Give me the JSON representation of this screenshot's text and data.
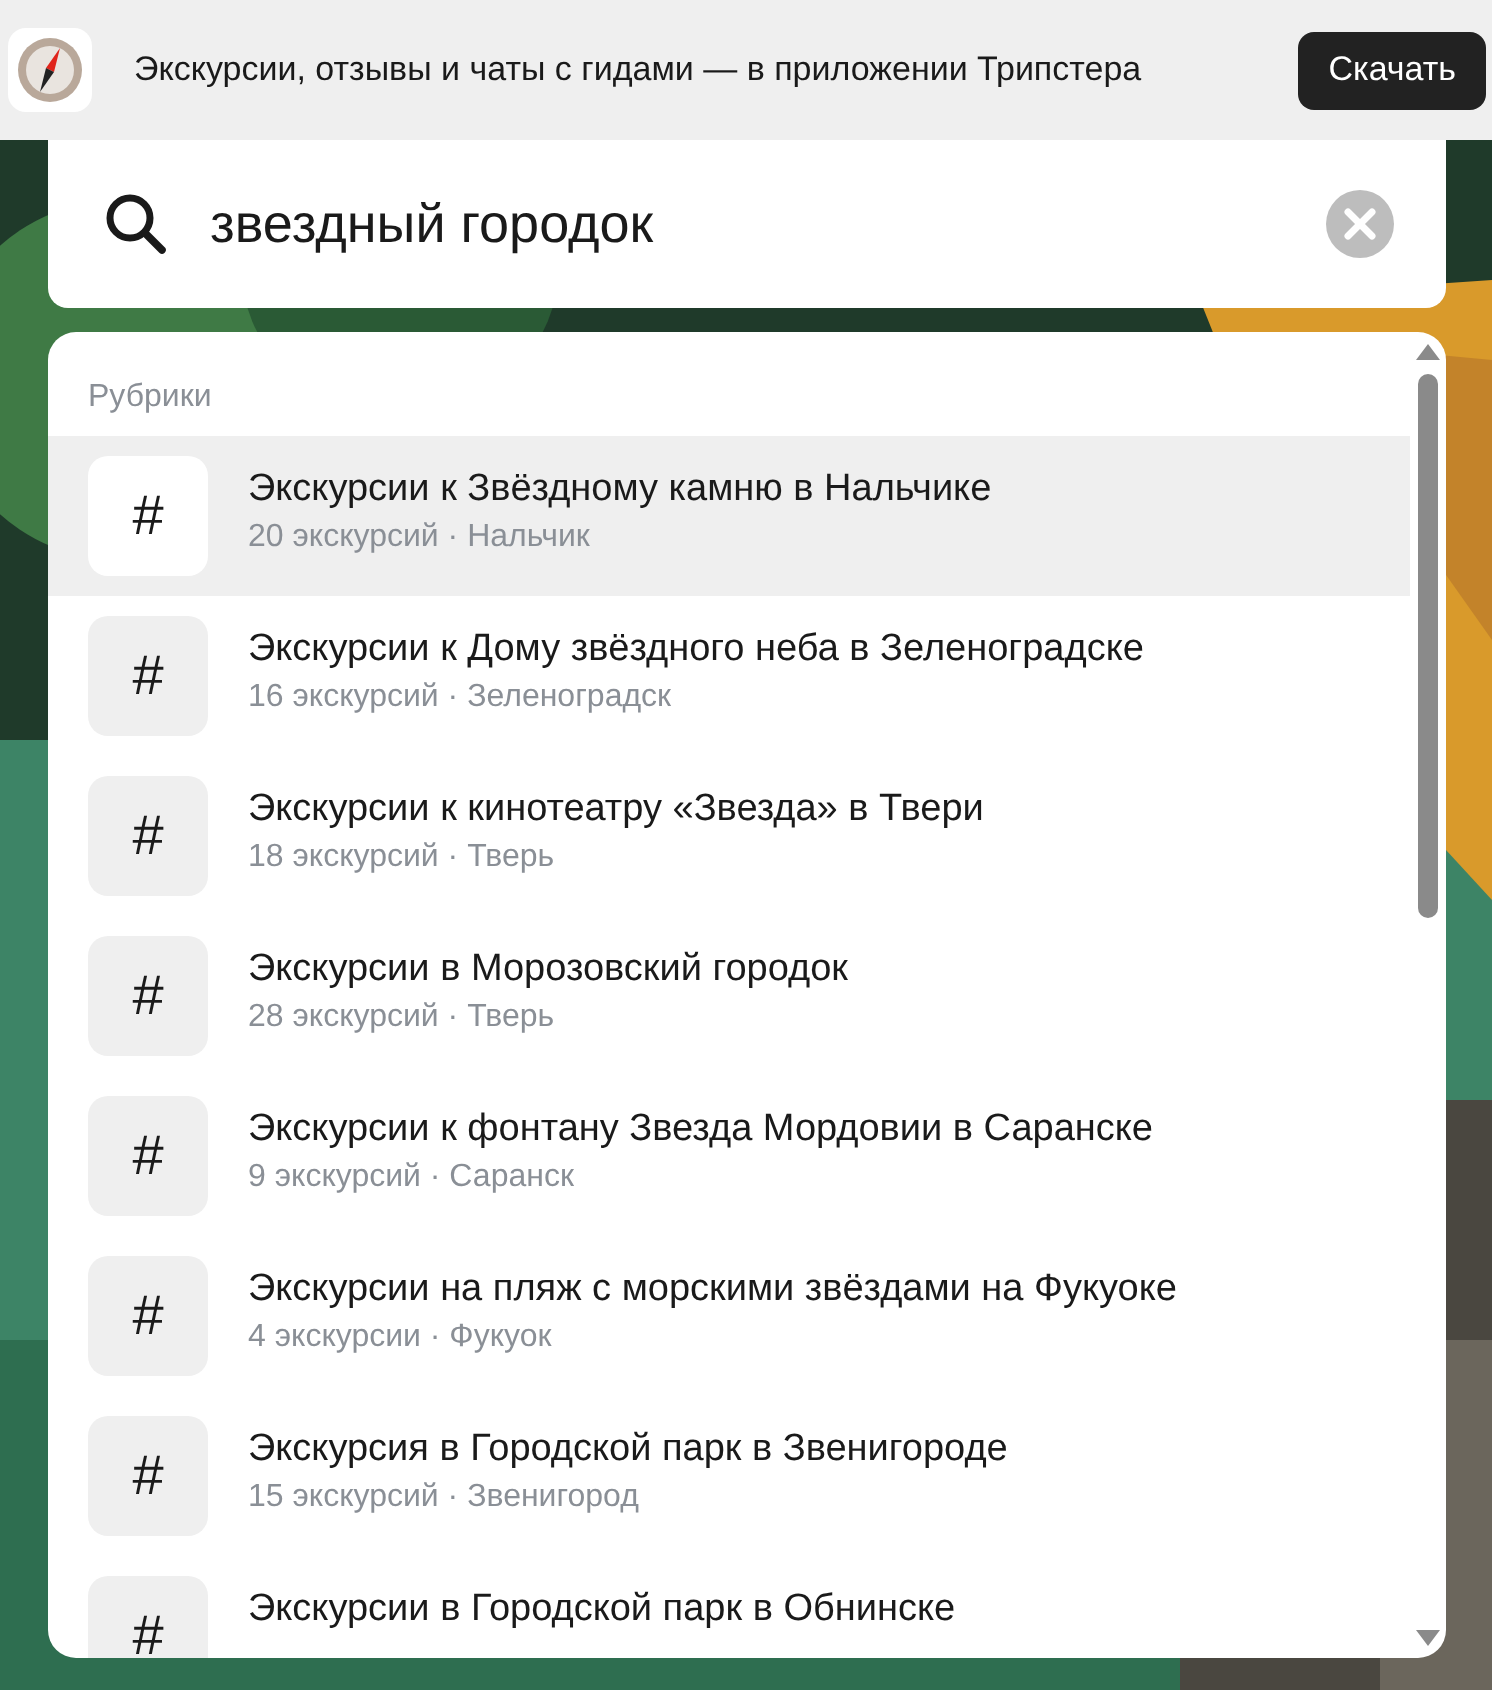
{
  "banner": {
    "text": "Экскурсии, отзывы и чаты с гидами — в приложении Трипстера",
    "button": "Скачать"
  },
  "search": {
    "value": "звездный городок"
  },
  "dropdown": {
    "section": "Рубрики",
    "items": [
      {
        "icon": "#",
        "title": "Экскурсии к Звёздному камню в Нальчике",
        "subtitle": "20 экскурсий · Нальчик",
        "selected": true
      },
      {
        "icon": "#",
        "title": "Экскурсии к Дому звёздного неба в Зеленоградске",
        "subtitle": "16 экскурсий · Зеленоградск",
        "selected": false
      },
      {
        "icon": "#",
        "title": "Экскурсии к кинотеатру «Звезда» в Твери",
        "subtitle": "18 экскурсий · Тверь",
        "selected": false
      },
      {
        "icon": "#",
        "title": "Экскурсии в Морозовский городок",
        "subtitle": "28 экскурсий · Тверь",
        "selected": false
      },
      {
        "icon": "#",
        "title": "Экскурсии к фонтану Звезда Мордовии в Саранске",
        "subtitle": "9 экскурсий · Саранск",
        "selected": false
      },
      {
        "icon": "#",
        "title": "Экскурсии на пляж с морскими звёздами на Фукуоке",
        "subtitle": "4 экскурсии · Фукуок",
        "selected": false
      },
      {
        "icon": "#",
        "title": "Экскурсия в Городской парк в Звенигороде",
        "subtitle": "15 экскурсий · Звенигород",
        "selected": false
      },
      {
        "icon": "#",
        "title": "Экскурсии в Городской парк в Обнинске",
        "selected": false
      }
    ]
  }
}
